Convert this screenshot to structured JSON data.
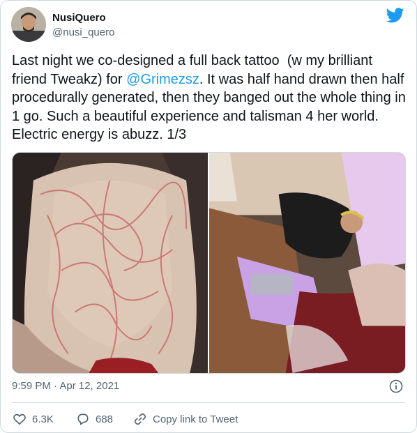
{
  "user": {
    "name": "NusiQuero",
    "handle": "@nusi_quero",
    "avatar_icon": "person-avatar"
  },
  "logo_icon": "twitter-bird-icon",
  "tweet": {
    "text_before": "Last night we co-designed a full back tattoo  (w my brilliant friend Tweakz) for ",
    "mention": "@Grimezsz",
    "text_after": ". It was half hand drawn then half procedurally generated, then they banged out the whole thing in 1 go. Such a beautiful experience and talisman 4 her world. Electric energy is abuzz. 1/3"
  },
  "media": [
    {
      "kind": "photo",
      "icon": "back-tattoo-photo"
    },
    {
      "kind": "photo",
      "icon": "tattoo-session-photo"
    }
  ],
  "timestamp": "9:59 PM · Apr 12, 2021",
  "actions": {
    "likes": "6.3K",
    "replies": "688",
    "copy_link": "Copy link to Tweet"
  },
  "colors": {
    "accent": "#1d9bf0",
    "text": "#0f1419",
    "muted": "#536471",
    "border": "#cfd9de"
  }
}
